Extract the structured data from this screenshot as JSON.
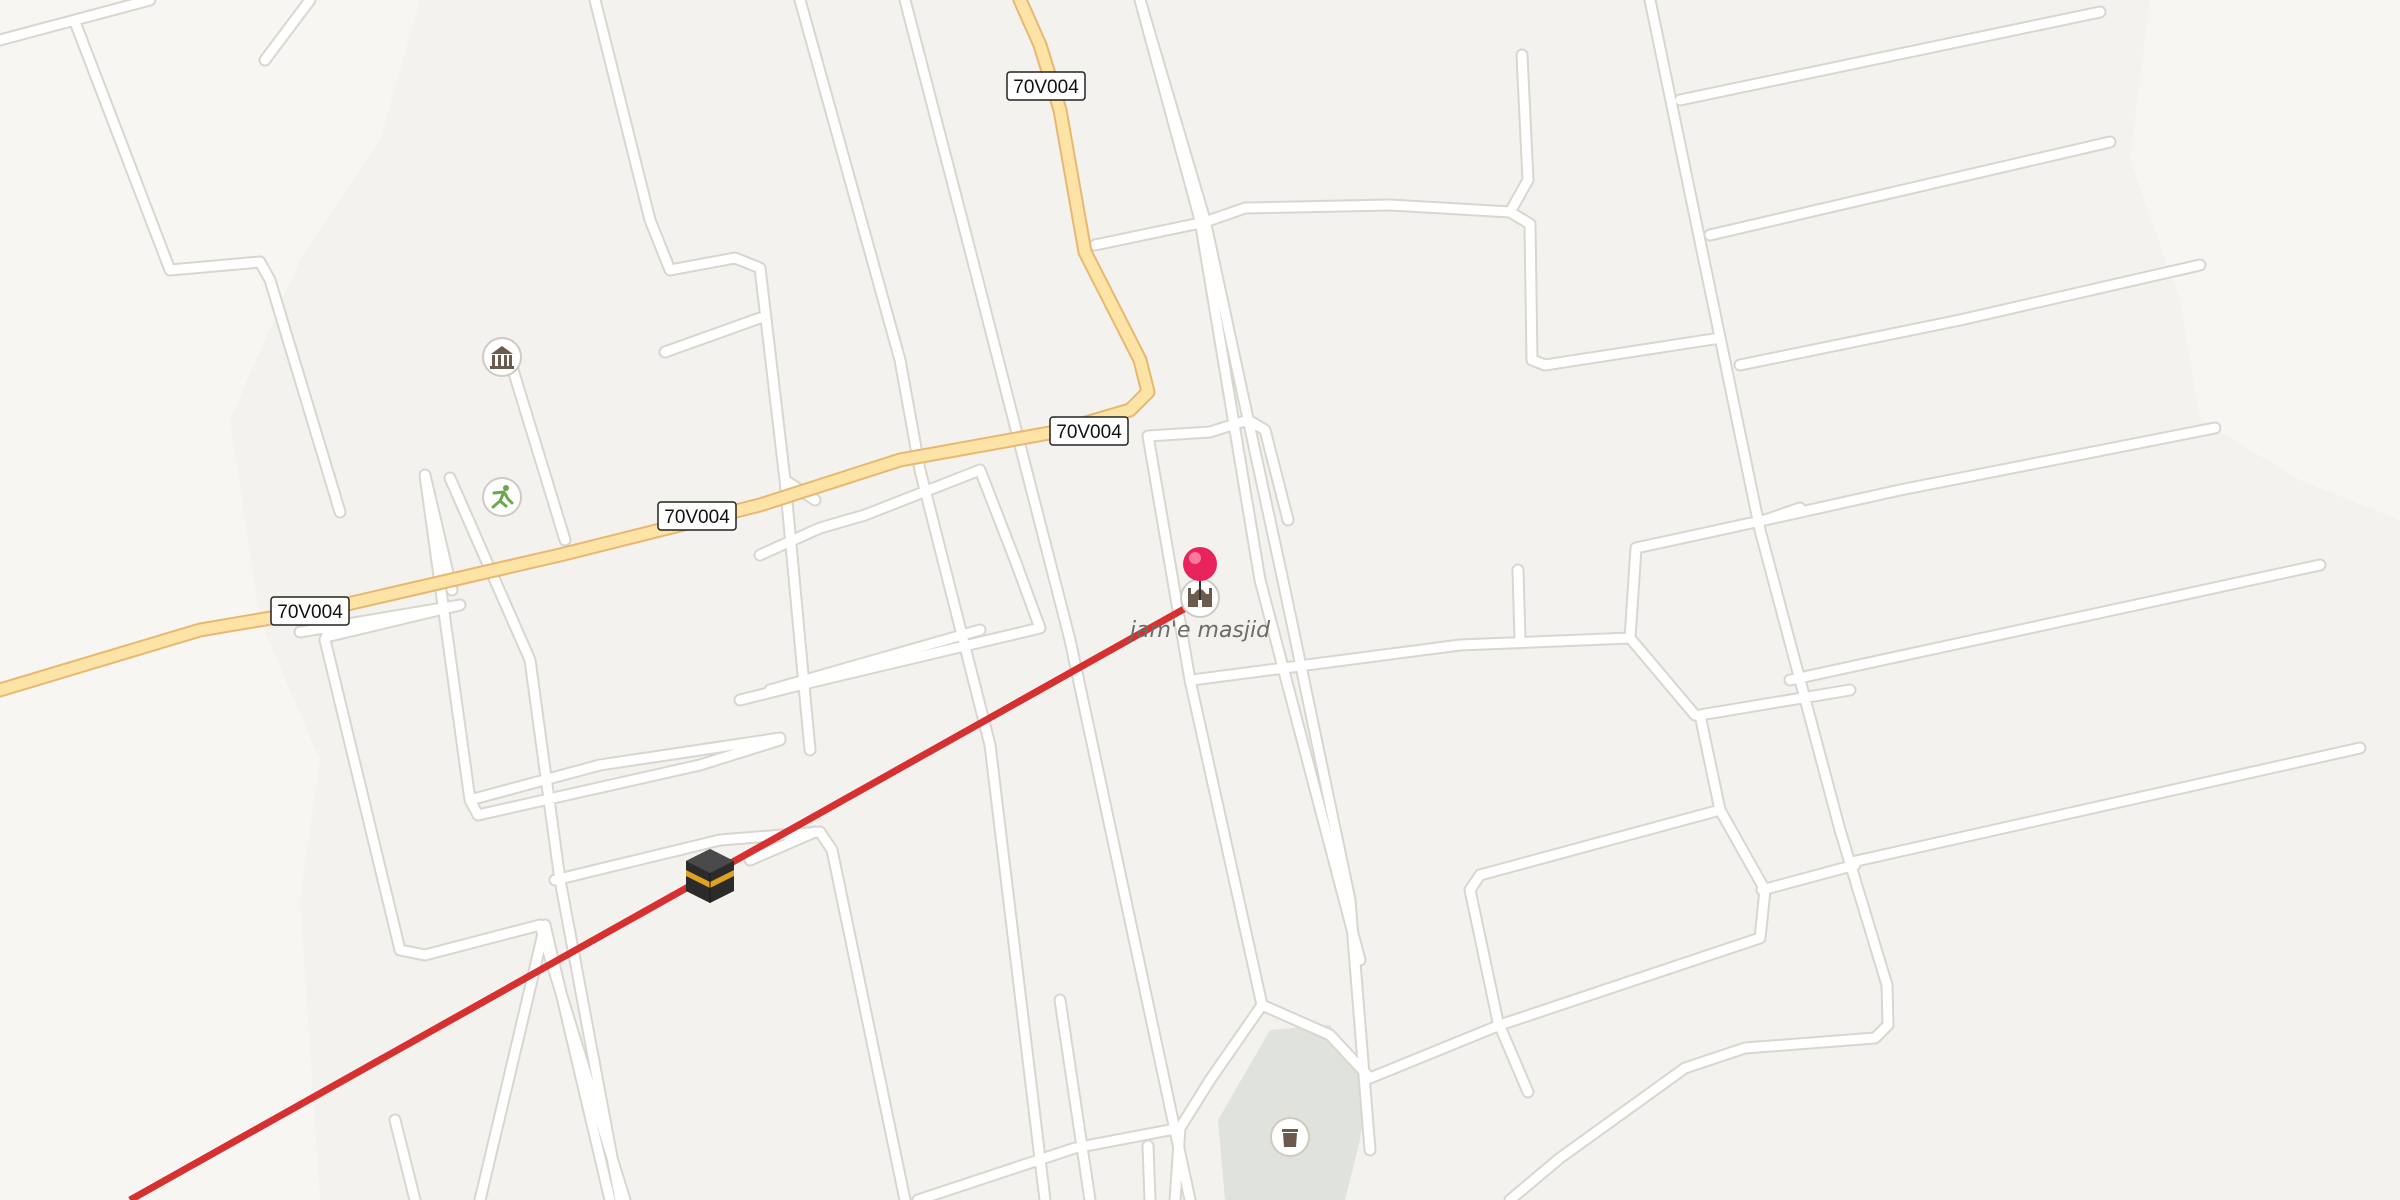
{
  "map": {
    "road_ref": "70V004",
    "place_name": "jam'e masjid",
    "colors": {
      "background": "#f3f2ef",
      "minor_road": "#ffffff",
      "main_road": "#fde3a5",
      "main_road_casing": "#e8b870",
      "qibla_line": "#d63031",
      "pin": "#e8245c",
      "cemetery": "#dfe3dc"
    },
    "icons": {
      "pin": "pin-marker-icon",
      "mosque": "mosque-icon",
      "kaaba": "kaaba-icon",
      "monument": "monument-icon",
      "sports": "sports-icon",
      "cemetery": "cemetery-icon"
    }
  }
}
